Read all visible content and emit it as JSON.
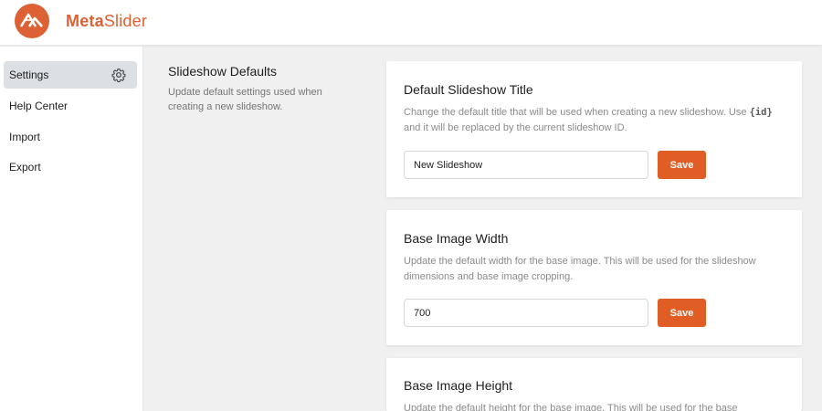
{
  "brand": {
    "part1": "Meta",
    "part2": "Slider",
    "color": "#dd6134"
  },
  "sidebar": {
    "items": [
      {
        "label": "Settings",
        "active": true,
        "icon": "gear-icon"
      },
      {
        "label": "Help Center",
        "active": false
      },
      {
        "label": "Import",
        "active": false
      },
      {
        "label": "Export",
        "active": false
      }
    ]
  },
  "section": {
    "title": "Slideshow Defaults",
    "description": "Update default settings used when creating a new slideshow."
  },
  "cards": [
    {
      "title": "Default Slideshow Title",
      "desc_before": "Change the default title that will be used when creating a new slideshow. Use ",
      "desc_code": "{id}",
      "desc_after": " and it will be replaced by the current slideshow ID.",
      "value": "New Slideshow",
      "button": "Save"
    },
    {
      "title": "Base Image Width",
      "desc": "Update the default width for the base image. This will be used for the slideshow dimensions and base image cropping.",
      "value": "700",
      "button": "Save"
    },
    {
      "title": "Base Image Height",
      "desc": "Update the default height for the base image. This will be used for the base"
    }
  ],
  "colors": {
    "accent": "#e05d25",
    "background": "#f0f0f1",
    "active_nav": "#dcdfe4"
  }
}
